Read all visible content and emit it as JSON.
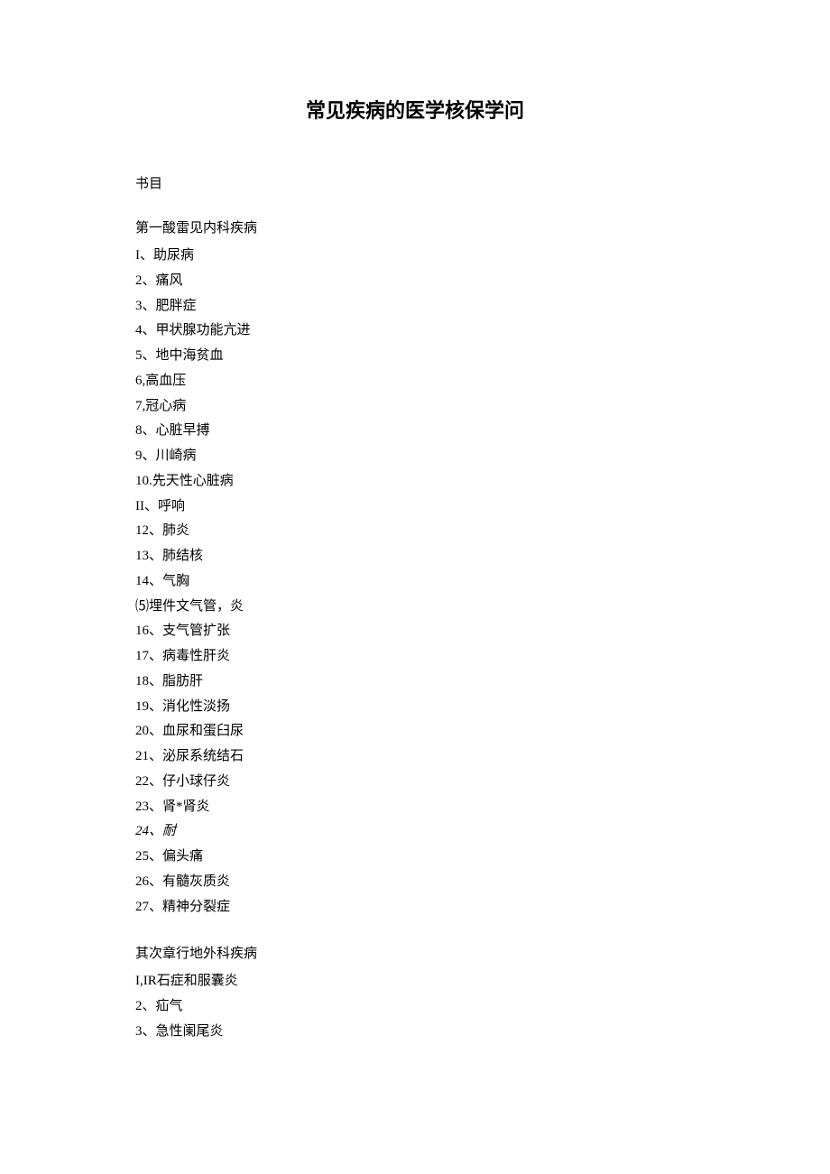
{
  "title": "常见疾病的医学核保学问",
  "section_label": "书目",
  "chapter1": {
    "heading": "第一酸雷见内科疾病",
    "items": [
      "I、助尿病",
      "2、痛风",
      "3、肥胖症",
      "4、甲状腺功能亢进",
      "5、地中海贫血",
      "6,高血压",
      "7,冠心病",
      "8、心脏早搏",
      "9、川崎病",
      "10.先天性心脏病",
      "II、呼响",
      "12、肺炎",
      "13、肺结核",
      "14、气胸",
      "⑸埋件文气管，炎",
      "16、支气管扩张",
      "17、病毒性肝炎",
      "18、脂肪肝",
      "19、消化性淡扬",
      "20、血尿和蛋臼尿",
      "21、泌尿系统结石",
      "22、仔小球仔炎",
      "23、肾*肾炎",
      "24、耐",
      "25、偏头痛",
      "26、有髓灰质炎",
      "27、精神分裂症"
    ]
  },
  "chapter2": {
    "heading": "其次章行地外科疾病",
    "items": [
      "I,IR石症和服囊炎",
      "2、疝气",
      "3、急性阑尾炎"
    ]
  }
}
